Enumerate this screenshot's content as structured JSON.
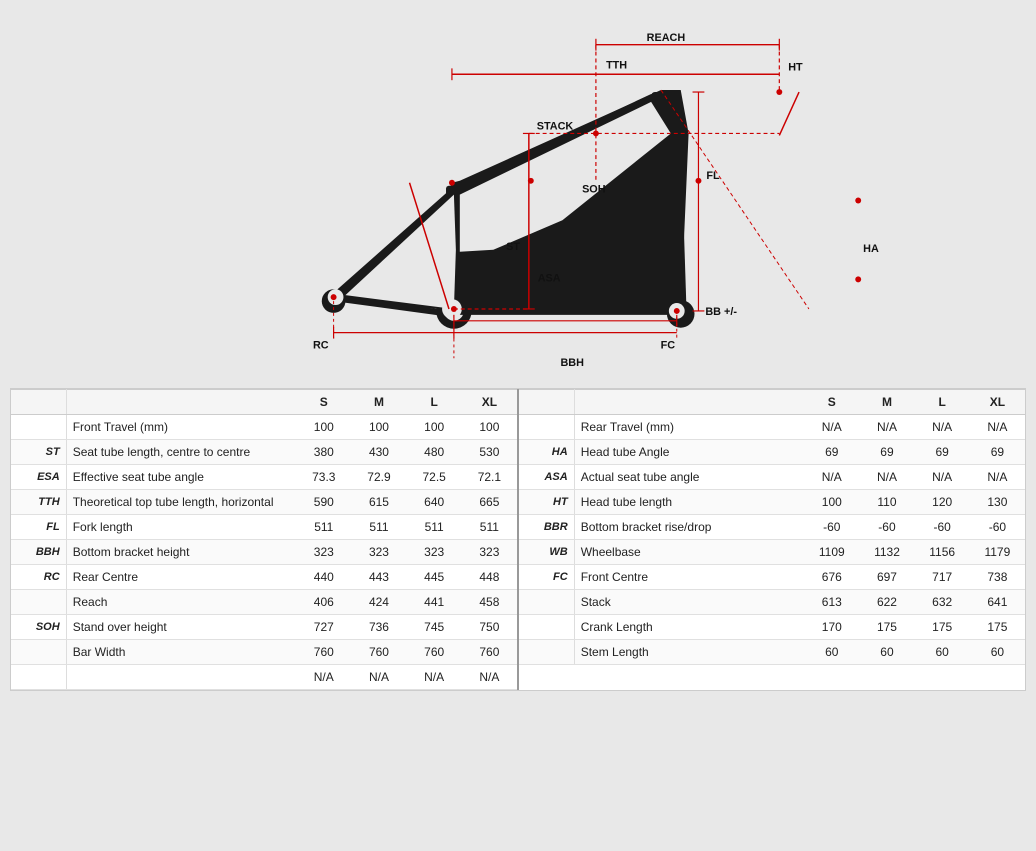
{
  "diagram": {
    "labels": [
      "REACH",
      "TTH",
      "HT",
      "STACK",
      "SOH",
      "FL",
      "ST",
      "ASA",
      "BB +/-",
      "RC",
      "FC",
      "BBH",
      "HA"
    ]
  },
  "table": {
    "sizes": [
      "S",
      "M",
      "L",
      "XL"
    ],
    "left": {
      "header_empty": "",
      "rows": [
        {
          "abbrev": "",
          "label": "Front Travel (mm)",
          "values": [
            "100",
            "100",
            "100",
            "100"
          ]
        },
        {
          "abbrev": "ST",
          "label": "Seat tube length, centre to centre",
          "values": [
            "380",
            "430",
            "480",
            "530"
          ]
        },
        {
          "abbrev": "ESA",
          "label": "Effective seat tube angle",
          "values": [
            "73.3",
            "72.9",
            "72.5",
            "72.1"
          ]
        },
        {
          "abbrev": "TTH",
          "label": "Theoretical top tube length, horizontal",
          "values": [
            "590",
            "615",
            "640",
            "665"
          ]
        },
        {
          "abbrev": "FL",
          "label": "Fork length",
          "values": [
            "511",
            "511",
            "511",
            "511"
          ]
        },
        {
          "abbrev": "BBH",
          "label": "Bottom bracket height",
          "values": [
            "323",
            "323",
            "323",
            "323"
          ]
        },
        {
          "abbrev": "RC",
          "label": "Rear Centre",
          "values": [
            "440",
            "443",
            "445",
            "448"
          ]
        },
        {
          "abbrev": "",
          "label": "Reach",
          "values": [
            "406",
            "424",
            "441",
            "458"
          ]
        },
        {
          "abbrev": "SOH",
          "label": "Stand over height",
          "values": [
            "727",
            "736",
            "745",
            "750"
          ]
        },
        {
          "abbrev": "",
          "label": "Bar Width",
          "values": [
            "760",
            "760",
            "760",
            "760"
          ]
        },
        {
          "abbrev": "",
          "label": "",
          "values": [
            "N/A",
            "N/A",
            "N/A",
            "N/A"
          ]
        }
      ]
    },
    "right": {
      "rows": [
        {
          "abbrev": "",
          "label": "Rear Travel (mm)",
          "values": [
            "N/A",
            "N/A",
            "N/A",
            "N/A"
          ]
        },
        {
          "abbrev": "HA",
          "label": "Head tube Angle",
          "values": [
            "69",
            "69",
            "69",
            "69"
          ]
        },
        {
          "abbrev": "ASA",
          "label": "Actual seat tube angle",
          "values": [
            "N/A",
            "N/A",
            "N/A",
            "N/A"
          ]
        },
        {
          "abbrev": "HT",
          "label": "Head tube length",
          "values": [
            "100",
            "110",
            "120",
            "130"
          ]
        },
        {
          "abbrev": "BBR",
          "label": "Bottom bracket rise/drop",
          "values": [
            "-60",
            "-60",
            "-60",
            "-60"
          ]
        },
        {
          "abbrev": "WB",
          "label": "Wheelbase",
          "values": [
            "1109",
            "1132",
            "1156",
            "1179"
          ]
        },
        {
          "abbrev": "FC",
          "label": "Front Centre",
          "values": [
            "676",
            "697",
            "717",
            "738"
          ]
        },
        {
          "abbrev": "",
          "label": "Stack",
          "values": [
            "613",
            "622",
            "632",
            "641"
          ]
        },
        {
          "abbrev": "",
          "label": "Crank Length",
          "values": [
            "170",
            "175",
            "175",
            "175"
          ]
        },
        {
          "abbrev": "",
          "label": "Stem Length",
          "values": [
            "60",
            "60",
            "60",
            "60"
          ]
        }
      ]
    }
  }
}
